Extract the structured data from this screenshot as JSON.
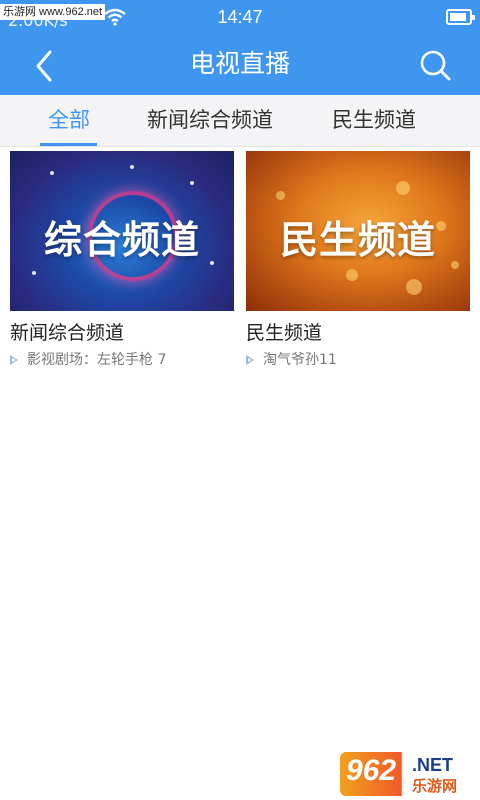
{
  "status_bar": {
    "watermark": "乐游网 www.962.net",
    "net_speed": "2.00K/s",
    "time": "14:47",
    "battery_level": 0.9
  },
  "header": {
    "title": "电视直播",
    "back_icon": "back-chevron-icon",
    "search_icon": "search-icon",
    "color": "#3e96ef"
  },
  "tabs": [
    {
      "label": "全部",
      "active": true
    },
    {
      "label": "新闻综合频道",
      "active": false
    },
    {
      "label": "民生频道",
      "active": false
    }
  ],
  "channels": [
    {
      "thumb_text": "综合频道",
      "name": "新闻综合频道",
      "now_playing": "影视剧场：左轮手枪 7"
    },
    {
      "thumb_text": "民生频道",
      "name": "民生频道",
      "now_playing": "淘气爷孙11"
    }
  ],
  "watermark_bottom": {
    "number": "962",
    "net": ".NET",
    "cn": "乐游网"
  },
  "colors": {
    "accent": "#3e96ef",
    "tab_bg": "#f4f4f6"
  }
}
